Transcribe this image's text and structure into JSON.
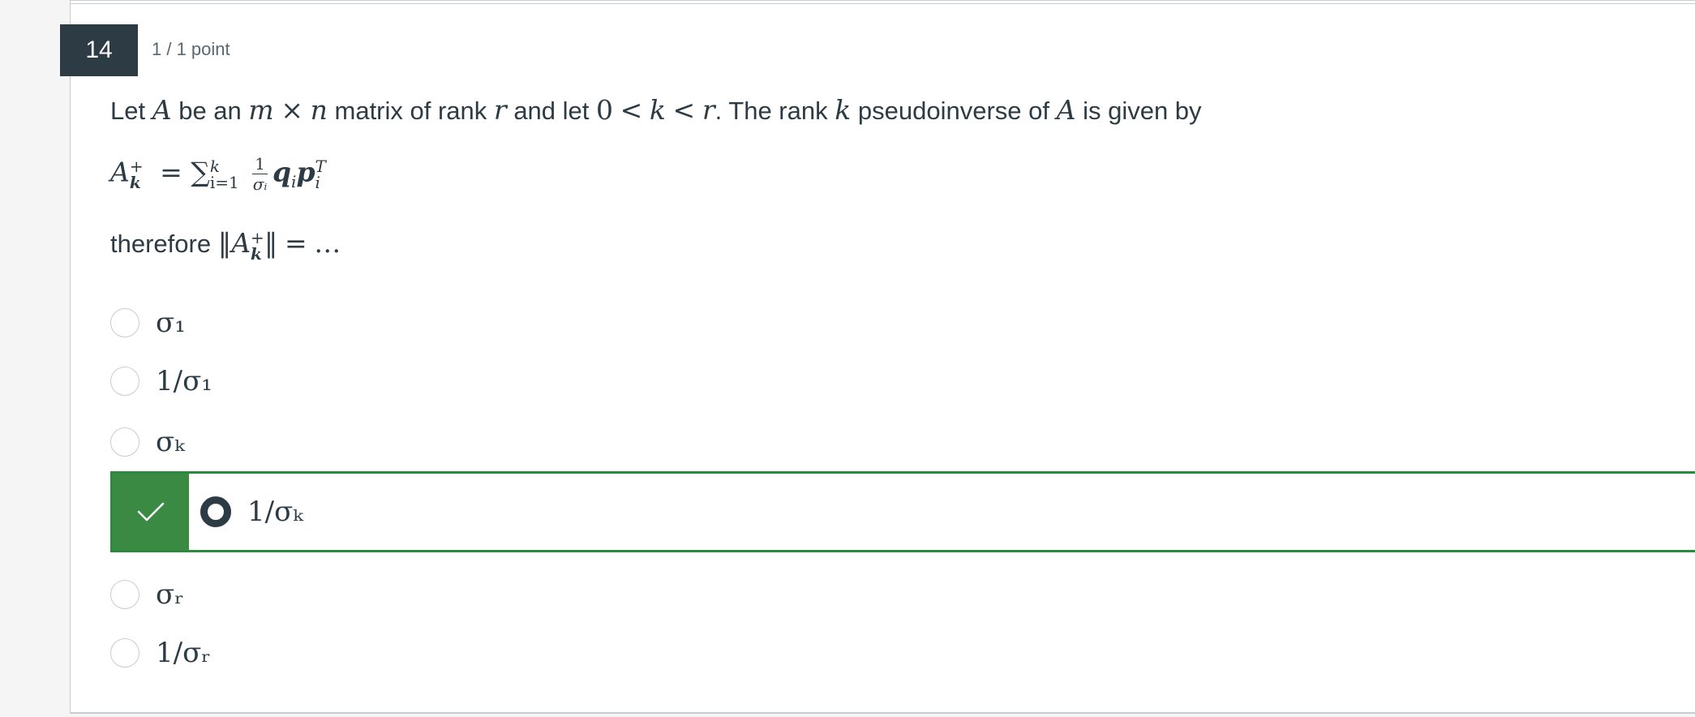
{
  "question": {
    "number": "14",
    "points": "1 / 1 point",
    "text": {
      "let": "Let",
      "A1": "A",
      "be_an": "be an",
      "m": "m",
      "times": "×",
      "n": "n",
      "matrix_of_rank": "matrix of rank",
      "r1": "r",
      "and_let": "and let",
      "zero": "0",
      "lt1": "<",
      "k1": "k",
      "lt2": "<",
      "r2": "r",
      "the_rank": ". The rank",
      "k2": "k",
      "pseudoinverse_of": "pseudoinverse of",
      "A2": "A",
      "is_given_by": "is given by"
    },
    "formula": {
      "A": "A",
      "sub_k": "k",
      "sup_plus": "+",
      "equals": "=",
      "sigma_sum": "∑",
      "sum_sub": "i=1",
      "sum_sup": "k",
      "frac_num": "1",
      "frac_den": "σᵢ",
      "q": "q",
      "q_sub": "i",
      "p": "p",
      "p_sub": "i",
      "p_sup": "T"
    },
    "therefore": {
      "word": "therefore",
      "norm_open": "‖",
      "A": "A",
      "sub_k": "k",
      "sup_plus": "+",
      "norm_close": "‖",
      "equals": "=",
      "dots": "…"
    }
  },
  "answers": [
    {
      "label": "σ₁",
      "selected": false,
      "correct": false
    },
    {
      "label": "1/σ₁",
      "selected": false,
      "correct": false
    },
    {
      "label": "σₖ",
      "selected": false,
      "correct": false
    },
    {
      "label": "1/σₖ",
      "selected": true,
      "correct": true
    },
    {
      "label": "σᵣ",
      "selected": false,
      "correct": false
    },
    {
      "label": "1/σᵣ",
      "selected": false,
      "correct": false
    }
  ],
  "colors": {
    "correct_green": "#3b8a44",
    "question_badge": "#2d3b45",
    "text": "#2d3b45"
  },
  "icons": {
    "correct": "checkmark-icon"
  }
}
